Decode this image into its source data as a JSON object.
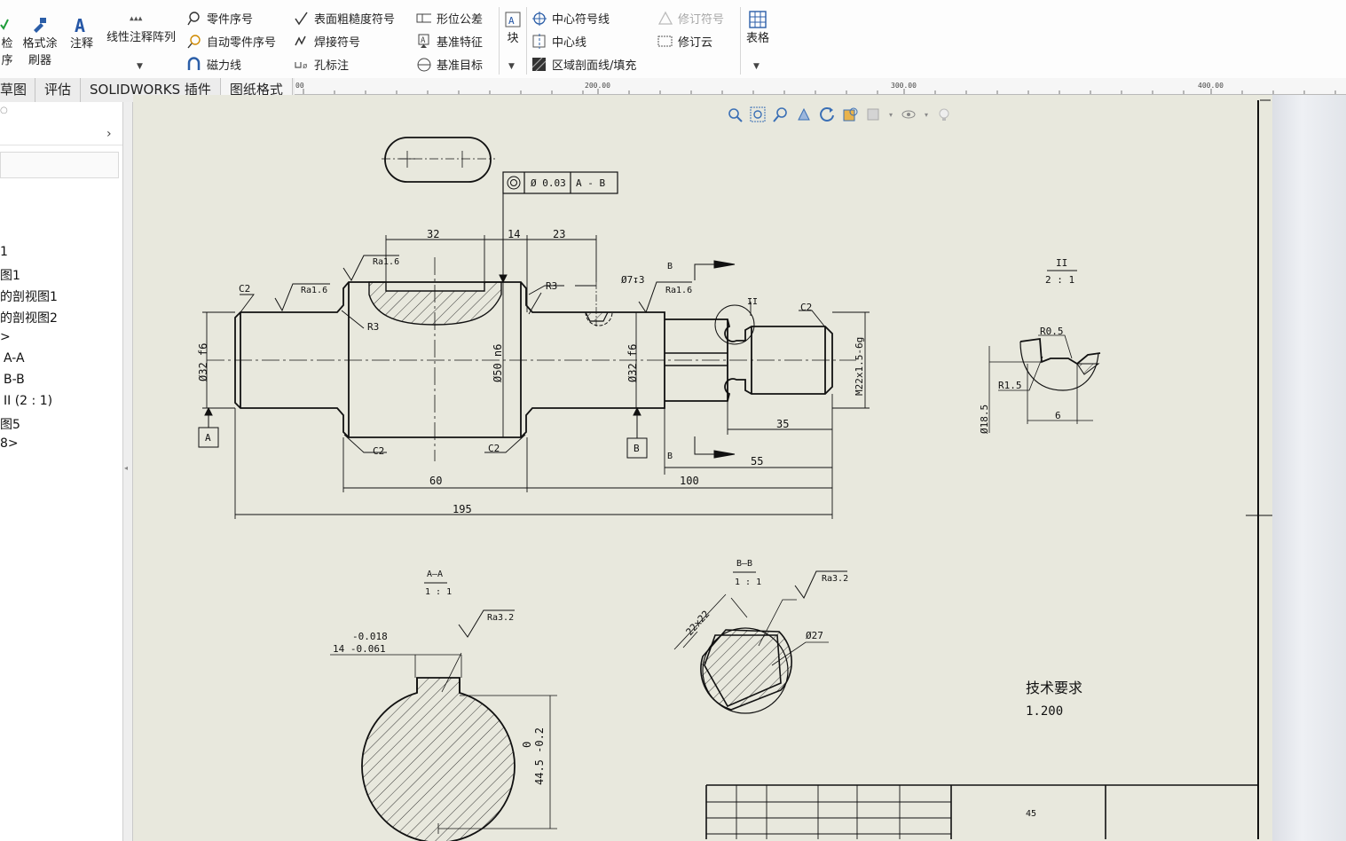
{
  "ribbon": {
    "big_left_1": "检\n序",
    "big_left_2": "格式涂\n刷器",
    "annotation": "注释",
    "linear_pattern": "线性注释阵列",
    "col1": [
      "零件序号",
      "自动零件序号",
      "磁力线"
    ],
    "col2": [
      "表面粗糙度符号",
      "焊接符号",
      "孔标注"
    ],
    "col3": [
      "形位公差",
      "基准特征",
      "基准目标"
    ],
    "block": "块",
    "col4": [
      "中心符号线",
      "中心线",
      "区域剖面线/填充"
    ],
    "col5": [
      "修订符号",
      "修订云"
    ],
    "table": "表格"
  },
  "tabs": [
    "草图",
    "评估",
    "SOLIDWORKS 插件",
    "图纸格式"
  ],
  "tree": [
    "1",
    "图1",
    "的剖视图1",
    "的剖视图2",
    ">",
    "A-A",
    "B-B",
    "II (2 : 1)",
    "图5",
    "8>"
  ],
  "ruler": [
    "00",
    "200.00",
    "300.00",
    "400.00"
  ],
  "drawing": {
    "fcf": {
      "tol": "Ø 0.03",
      "datum": "A - B"
    },
    "dims_top": [
      "32",
      "14",
      "23"
    ],
    "roughness": [
      "Ra1.6",
      "Ra1.6",
      "Ra1.6",
      "Ra3.2",
      "Ra3.2"
    ],
    "chamfers": [
      "C2",
      "C2",
      "C2",
      "C2"
    ],
    "radii": [
      "R3",
      "R3"
    ],
    "hole": "Ø7↧3",
    "section_letter": "B",
    "detail_label": "II",
    "diameters": {
      "d1": "Ø32 f6",
      "d2": "Ø50 n6",
      "d3": "Ø32 f6",
      "thread": "M22x1.5-6g"
    },
    "datums": [
      "A",
      "B"
    ],
    "lengths": {
      "l35": "35",
      "l55": "55",
      "l60": "60",
      "l100": "100",
      "l195": "195"
    },
    "detail": {
      "title": "II",
      "scale": "2 : 1",
      "r05": "R0.5",
      "r15": "R1.5",
      "d185": "Ø18.5",
      "w6": "6"
    },
    "section_aa": {
      "title": "A—A",
      "scale": "1 : 1",
      "tol_upper": "-0.018",
      "tol_lower": "14 -0.061",
      "dim_v": "44.5 -0.2",
      "dim_v_upper": "0"
    },
    "section_bb": {
      "title": "B—B",
      "scale": "1 : 1",
      "size": "22x22",
      "dia": "Ø27"
    },
    "tech_title": "技术要求",
    "tech_body": "1.200",
    "title_block_material": "45"
  }
}
